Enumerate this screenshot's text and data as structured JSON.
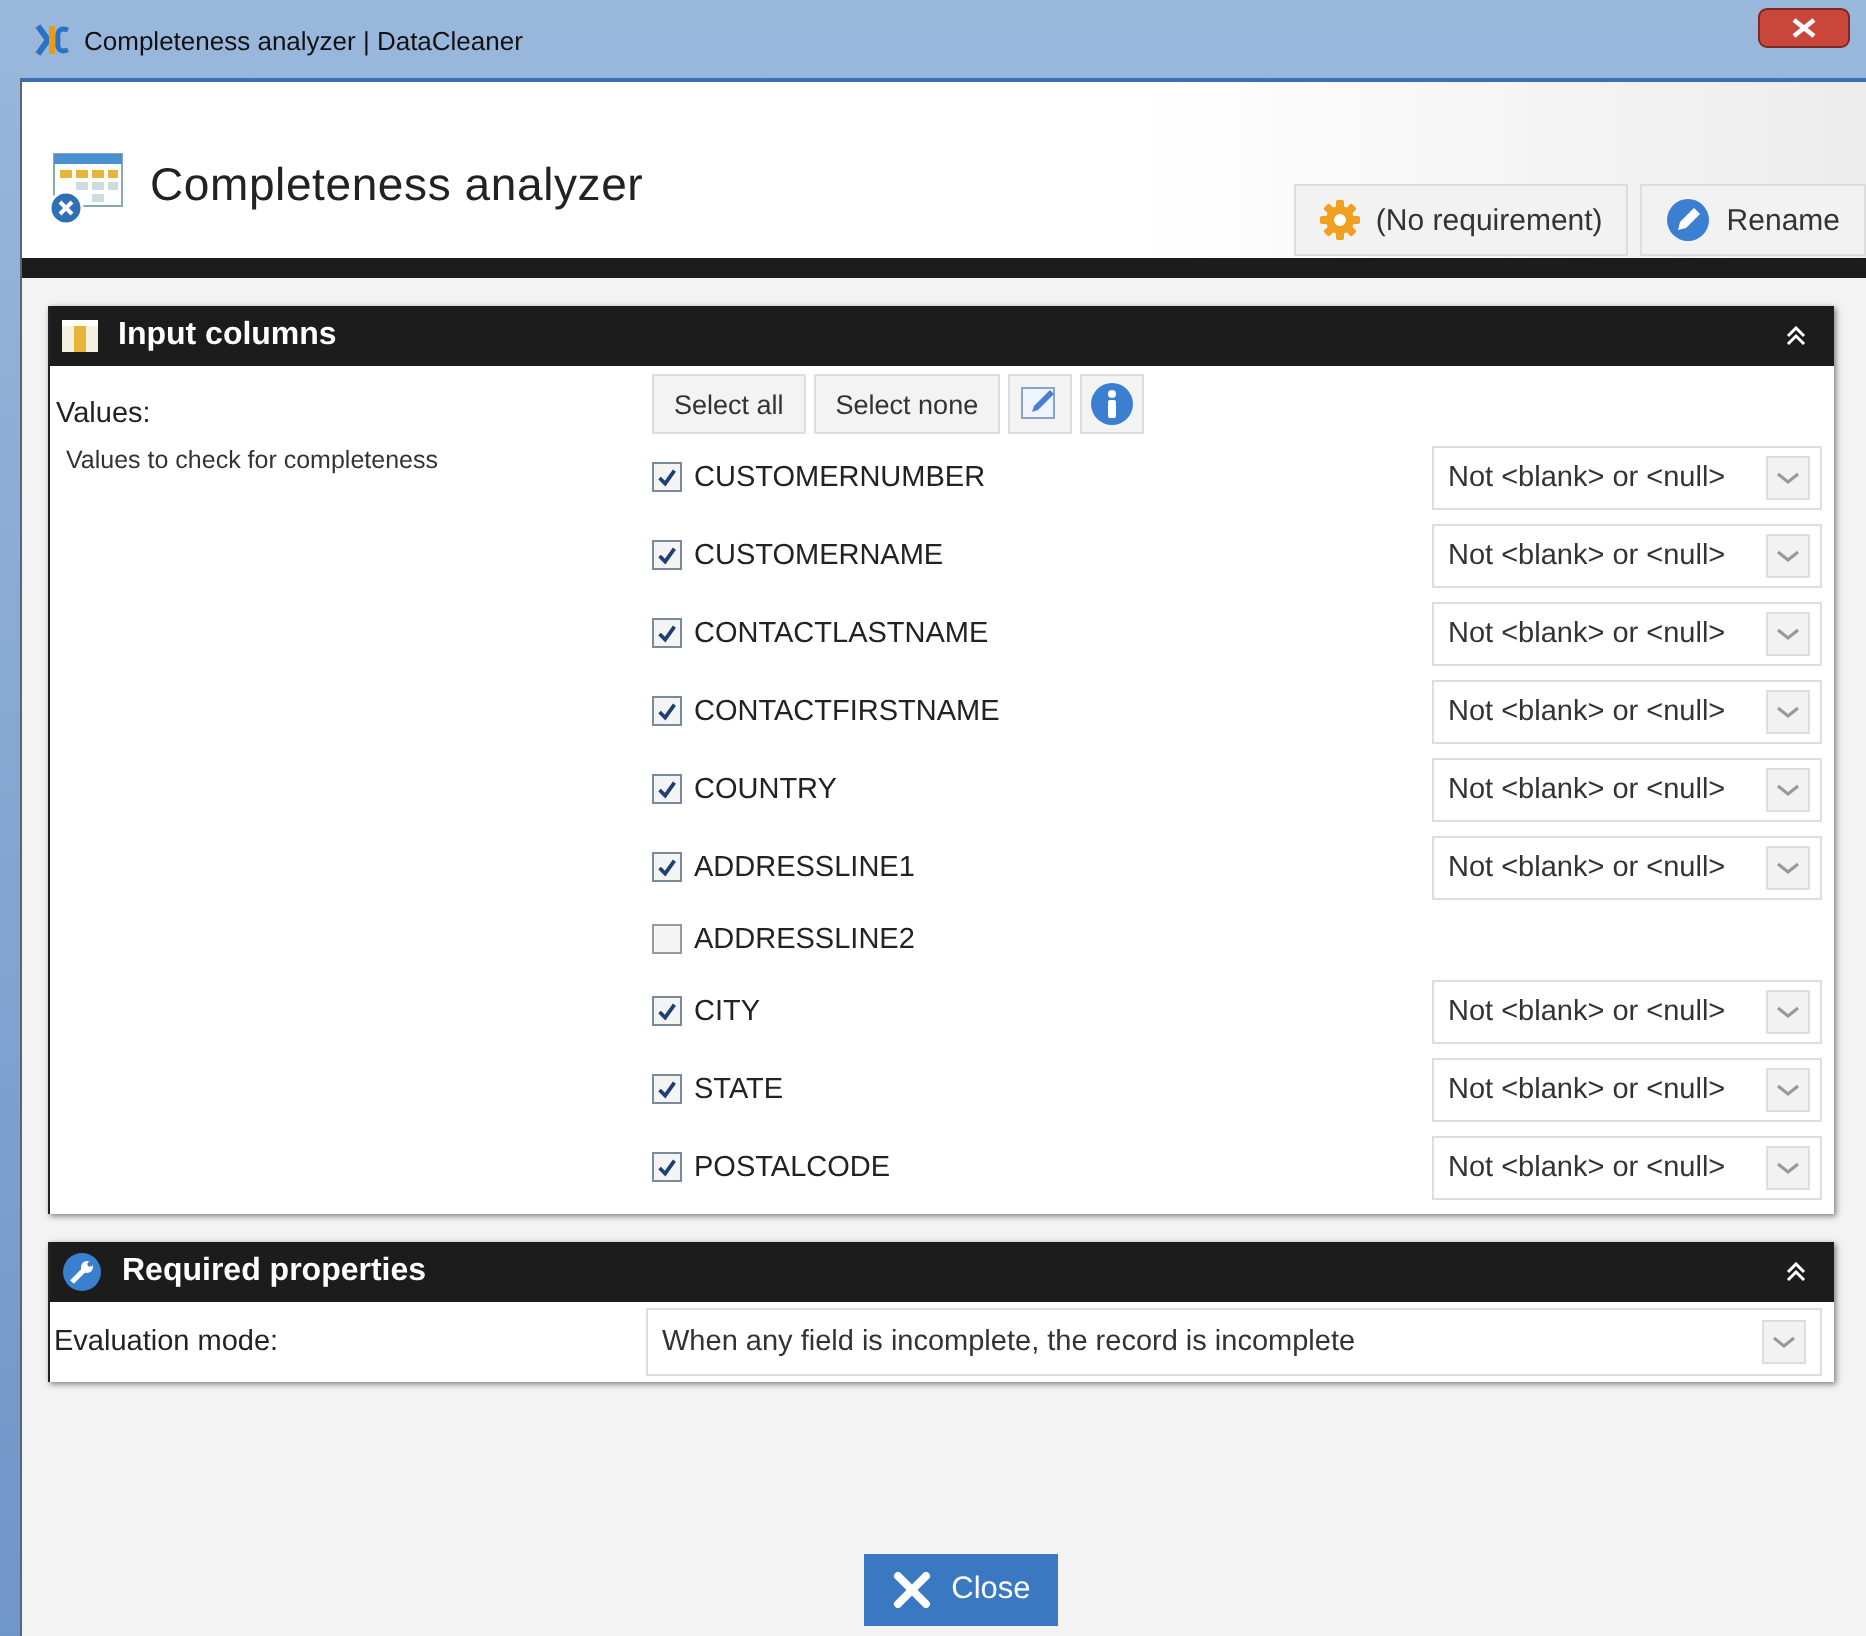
{
  "window": {
    "title": "Completeness analyzer | DataCleaner"
  },
  "header": {
    "title": "Completeness analyzer",
    "buttons": [
      {
        "label": "(No requirement)",
        "kind": "gear"
      },
      {
        "label": "Rename",
        "kind": "pencil"
      }
    ]
  },
  "input_columns": {
    "title": "Input columns",
    "label": "Values:",
    "description": "Values to check for completeness",
    "buttons": [
      "Select all",
      "Select none"
    ],
    "columns": [
      {
        "name": "CUSTOMERNUMBER",
        "checked": true,
        "condition": "Not <blank> or <null>"
      },
      {
        "name": "CUSTOMERNAME",
        "checked": true,
        "condition": "Not <blank> or <null>"
      },
      {
        "name": "CONTACTLASTNAME",
        "checked": true,
        "condition": "Not <blank> or <null>"
      },
      {
        "name": "CONTACTFIRSTNAME",
        "checked": true,
        "condition": "Not <blank> or <null>"
      },
      {
        "name": "COUNTRY",
        "checked": true,
        "condition": "Not <blank> or <null>"
      },
      {
        "name": "ADDRESSLINE1",
        "checked": true,
        "condition": "Not <blank> or <null>"
      },
      {
        "name": "ADDRESSLINE2",
        "checked": false
      },
      {
        "name": "CITY",
        "checked": true,
        "condition": "Not <blank> or <null>"
      },
      {
        "name": "STATE",
        "checked": true,
        "condition": "Not <blank> or <null>"
      },
      {
        "name": "POSTALCODE",
        "checked": true,
        "condition": "Not <blank> or <null>"
      }
    ]
  },
  "required_properties": {
    "title": "Required properties",
    "property": {
      "label": "Evaluation mode:",
      "value": "When any field is incomplete, the record is incomplete"
    }
  },
  "close_button": {
    "label": "Close"
  }
}
